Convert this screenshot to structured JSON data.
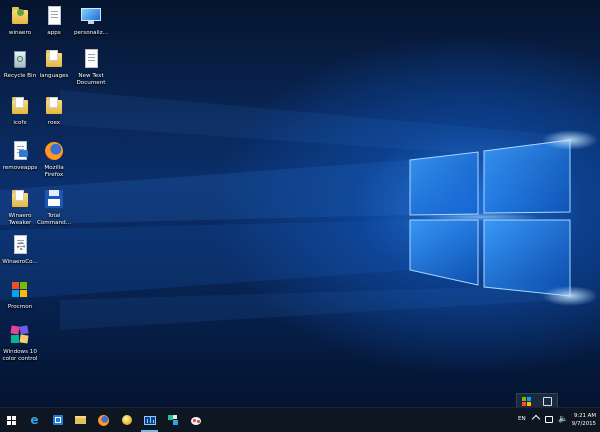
{
  "desktop": {
    "icons": [
      {
        "label": "winaero",
        "icon": "winaero-user-icon"
      },
      {
        "label": "apps",
        "icon": "document-icon"
      },
      {
        "label": "personaliz...",
        "icon": "monitor-icon"
      },
      {
        "label": "Recycle Bin",
        "icon": "recycle-bin-icon"
      },
      {
        "label": "languages",
        "icon": "folder-icon"
      },
      {
        "label": "New Text Document",
        "icon": "text-document-icon"
      },
      {
        "label": "icofx",
        "icon": "folder-icon"
      },
      {
        "label": "roex",
        "icon": "folder-icon"
      },
      {
        "label": "removeapps",
        "icon": "script-icon"
      },
      {
        "label": "Mozilla Firefox",
        "icon": "firefox-icon"
      },
      {
        "label": "Winaero Tweaker",
        "icon": "folder-icon"
      },
      {
        "label": "Total Command...",
        "icon": "floppy-disk-icon"
      },
      {
        "label": "WinaeroCo...",
        "icon": "gear-document-icon"
      },
      {
        "label": "Procmon",
        "icon": "windows-logo-icon"
      },
      {
        "label": "Windows 10 color control",
        "icon": "color-palette-icon"
      }
    ]
  },
  "taskbar": {
    "items": [
      {
        "name": "start-button",
        "icon": "windows-start-icon"
      },
      {
        "name": "edge-button",
        "icon": "edge-icon"
      },
      {
        "name": "store-button",
        "icon": "store-icon"
      },
      {
        "name": "file-explorer-button",
        "icon": "folder-icon"
      },
      {
        "name": "firefox-button",
        "icon": "firefox-icon"
      },
      {
        "name": "app-button",
        "icon": "yellow-orb-icon"
      },
      {
        "name": "task-manager-button",
        "icon": "monitor-chart-icon"
      },
      {
        "name": "tweaker-button",
        "icon": "tools-icon"
      },
      {
        "name": "paint-button",
        "icon": "paint-icon"
      }
    ],
    "language": "EN",
    "clock": {
      "time": "9:21 AM",
      "date": "9/7/2015"
    }
  },
  "colors": {
    "accent": "#76b9ed",
    "taskbar": "#0e1621",
    "wallpaper": "#0b2f6b"
  }
}
